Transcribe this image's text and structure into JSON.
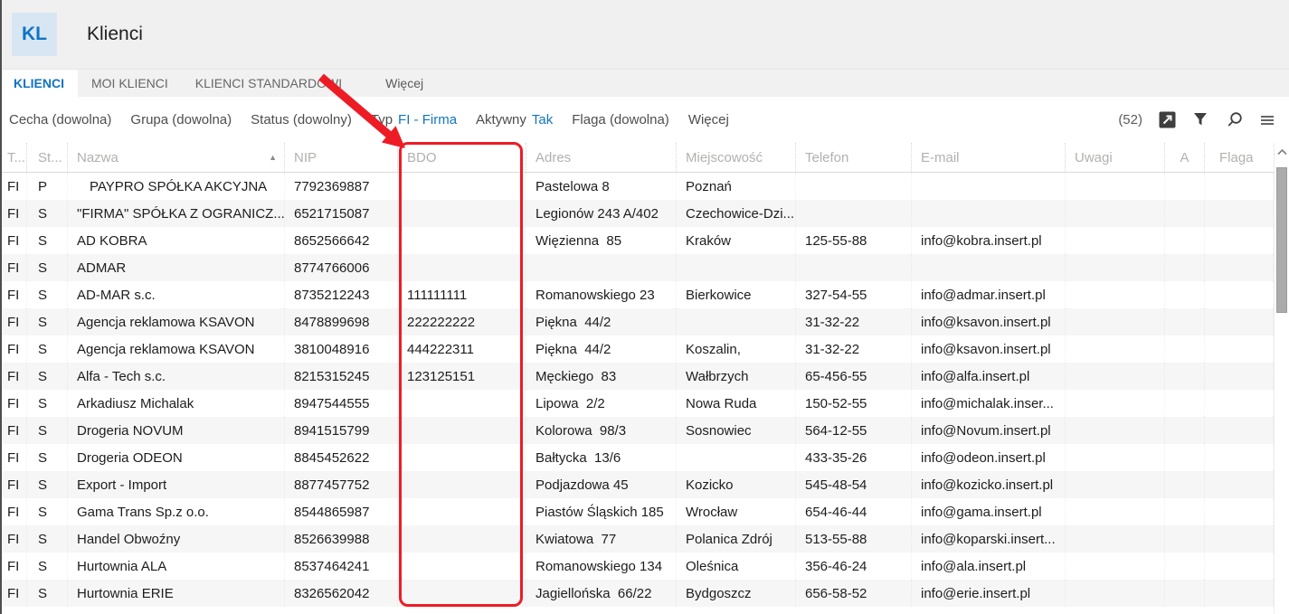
{
  "window": {
    "badge": "KL",
    "title": "Klienci"
  },
  "tabs": [
    {
      "label": "KLIENCI",
      "active": true
    },
    {
      "label": "MOI KLIENCI",
      "active": false
    },
    {
      "label": "KLIENCI STANDARDOWI",
      "active": false
    },
    {
      "label": "Więcej",
      "active": false,
      "more": true
    }
  ],
  "filters": [
    {
      "label": "Cecha (dowolna)"
    },
    {
      "label": "Grupa (dowolna)"
    },
    {
      "label": "Status (dowolny)"
    },
    {
      "label": "Typ",
      "value": "FI - Firma"
    },
    {
      "label": "Aktywny",
      "value": "Tak"
    },
    {
      "label": "Flaga (dowolna)"
    },
    {
      "label": "Więcej"
    }
  ],
  "toolbar": {
    "count": "(52)",
    "icons": [
      "export-icon",
      "filter-icon",
      "search-icon",
      "menu-icon"
    ]
  },
  "table": {
    "columns": [
      {
        "key": "typ",
        "label": "T..."
      },
      {
        "key": "status",
        "label": "St..."
      },
      {
        "key": "nazwa",
        "label": "Nazwa",
        "sorted": "asc"
      },
      {
        "key": "nip",
        "label": "NIP"
      },
      {
        "key": "bdo",
        "label": "BDO"
      },
      {
        "key": "adres",
        "label": "Adres"
      },
      {
        "key": "miejscowosc",
        "label": "Miejscowość"
      },
      {
        "key": "telefon",
        "label": "Telefon"
      },
      {
        "key": "email",
        "label": "E-mail"
      },
      {
        "key": "uwagi",
        "label": "Uwagi"
      },
      {
        "key": "a",
        "label": "A"
      },
      {
        "key": "flaga",
        "label": "Flaga"
      }
    ],
    "rows": [
      {
        "name_indent": true,
        "cells": [
          "FI",
          "P",
          "PAYPRO SPÓŁKA AKCYJNA",
          "7792369887",
          "",
          "Pastelowa 8",
          "Poznań",
          "",
          "",
          "",
          "",
          ""
        ]
      },
      {
        "cells": [
          "FI",
          "S",
          "\"FIRMA\" SPÓŁKA Z OGRANICZ...",
          "6521715087",
          "",
          "Legionów 243 A/402",
          "Czechowice-Dzi...",
          "",
          "",
          "",
          "",
          ""
        ]
      },
      {
        "cells": [
          "FI",
          "S",
          "AD KOBRA",
          "8652566642",
          "",
          "Więzienna  85",
          "Kraków",
          "125-55-88",
          "info@kobra.insert.pl",
          "",
          "",
          ""
        ]
      },
      {
        "cells": [
          "FI",
          "S",
          "ADMAR",
          "8774766006",
          "",
          "",
          "",
          "",
          "",
          "",
          "",
          ""
        ]
      },
      {
        "cells": [
          "FI",
          "S",
          "AD-MAR s.c.",
          "8735212243",
          "111111111",
          "Romanowskiego 23",
          "Bierkowice",
          "327-54-55",
          "info@admar.insert.pl",
          "",
          "",
          ""
        ]
      },
      {
        "cells": [
          "FI",
          "S",
          "Agencja reklamowa KSAVON",
          "8478899698",
          "222222222",
          "Piękna  44/2",
          "",
          "31-32-22",
          "info@ksavon.insert.pl",
          "",
          "",
          ""
        ]
      },
      {
        "cells": [
          "FI",
          "S",
          "Agencja reklamowa KSAVON",
          "3810048916",
          "444222311",
          "Piękna  44/2",
          "Koszalin,",
          "31-32-22",
          "info@ksavon.insert.pl",
          "",
          "",
          ""
        ]
      },
      {
        "cells": [
          "FI",
          "S",
          "Alfa - Tech s.c.",
          "8215315245",
          "123125151",
          "Męckiego  83",
          "Wałbrzych",
          "65-456-55",
          "info@alfa.insert.pl",
          "",
          "",
          ""
        ]
      },
      {
        "cells": [
          "FI",
          "S",
          "Arkadiusz Michalak",
          "8947544555",
          "",
          "Lipowa  2/2",
          "Nowa Ruda",
          "150-52-55",
          "info@michalak.inser...",
          "",
          "",
          ""
        ]
      },
      {
        "cells": [
          "FI",
          "S",
          "Drogeria NOVUM",
          "8941515799",
          "",
          "Kolorowa  98/3",
          "Sosnowiec",
          "564-12-55",
          "info@Novum.insert.pl",
          "",
          "",
          ""
        ]
      },
      {
        "cells": [
          "FI",
          "S",
          "Drogeria ODEON",
          "8845452622",
          "",
          "Bałtycka  13/6",
          "",
          "433-35-26",
          "info@odeon.insert.pl",
          "",
          "",
          ""
        ]
      },
      {
        "cells": [
          "FI",
          "S",
          "Export - Import",
          "8877457752",
          "",
          "Podjazdowa 45",
          "Kozicko",
          "545-48-54",
          "info@kozicko.insert.pl",
          "",
          "",
          ""
        ]
      },
      {
        "cells": [
          "FI",
          "S",
          "Gama Trans Sp.z o.o.",
          "8544865987",
          "",
          "Piastów Śląskich 185",
          "Wrocław",
          "654-46-44",
          "info@gama.insert.pl",
          "",
          "",
          ""
        ]
      },
      {
        "cells": [
          "FI",
          "S",
          "Handel Obwoźny",
          "8526639988",
          "",
          "Kwiatowa  77",
          "Polanica Zdrój",
          "513-55-88",
          "info@koparski.insert...",
          "",
          "",
          ""
        ]
      },
      {
        "cells": [
          "FI",
          "S",
          "Hurtownia ALA",
          "8537464241",
          "",
          "Romanowskiego 134",
          "Oleśnica",
          "356-46-24",
          "info@ala.insert.pl",
          "",
          "",
          ""
        ]
      },
      {
        "cells": [
          "FI",
          "S",
          "Hurtownia ERIE",
          "8326562042",
          "",
          "Jagiellońska  66/22",
          "Bydgoszcz",
          "656-58-52",
          "info@erie.insert.pl",
          "",
          "",
          ""
        ]
      }
    ]
  },
  "annotation": {
    "type": "arrow-and-rounded-box",
    "highlighted_column": "BDO",
    "color": "#ed1c24"
  }
}
